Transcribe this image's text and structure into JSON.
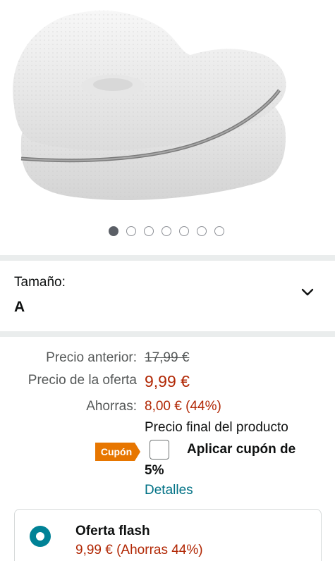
{
  "gallery": {
    "image": "leg-pillow-product-image",
    "total_images": 7,
    "active_index": 0
  },
  "size_selector": {
    "label": "Tamaño:",
    "value": "A",
    "icon": "chevron-down-icon"
  },
  "pricing": {
    "previous_label": "Precio anterior:",
    "previous_value": "17,99 €",
    "deal_label": "Precio de la oferta",
    "deal_value": "9,99 €",
    "savings_label": "Ahorras:",
    "savings_value": "8,00 € (44%)",
    "final_note": "Precio final del producto"
  },
  "coupon": {
    "badge": "Cupón",
    "apply_label": "Aplicar cupón de",
    "amount": "5%",
    "details_link": "Detalles",
    "checked": false
  },
  "flash_offer": {
    "title": "Oferta flash",
    "price": "9,99 € (Ahorras 44%)",
    "selected": true
  },
  "colors": {
    "price_red": "#b12704",
    "link_teal": "#007185",
    "radio_teal": "#008296",
    "coupon_orange": "#e77600",
    "divider_gray": "#eaeded"
  }
}
